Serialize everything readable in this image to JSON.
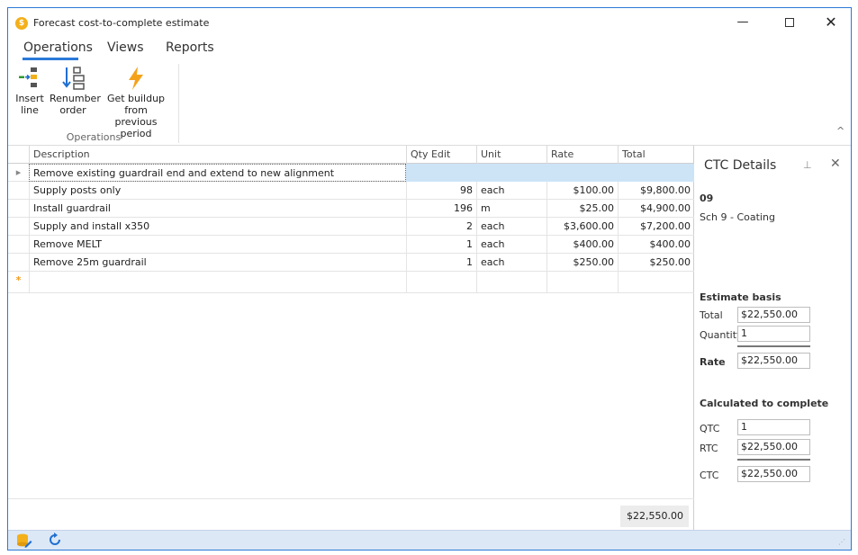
{
  "window": {
    "title": "Forecast cost-to-complete estimate",
    "icon_glyph": "$",
    "controls": {
      "minimize": "—",
      "maximize": "□",
      "close": "✕"
    }
  },
  "ribbon": {
    "tabs": [
      "Operations",
      "Views",
      "Reports"
    ],
    "active_tab": "Operations",
    "buttons": [
      {
        "label": "Insert line",
        "line1": "Insert",
        "line2": "line",
        "icon": "insert-line-icon"
      },
      {
        "label": "Renumber order",
        "line1": "Renumber",
        "line2": "order",
        "icon": "renumber-order-icon"
      },
      {
        "label": "Get buildup from previous period",
        "line1": "Get buildup from",
        "line2": "previous period",
        "icon": "lightning-icon"
      }
    ],
    "group_label": "Operations",
    "collapse_glyph": "^"
  },
  "grid": {
    "columns": [
      "Description",
      "Qty Edit",
      "Unit",
      "Rate",
      "Total"
    ],
    "rows": [
      {
        "indicator": "▸",
        "description": "Remove existing guardrail end and extend to new alignment",
        "qty": "",
        "unit": "",
        "rate": "",
        "total": "",
        "selected": true
      },
      {
        "indicator": "",
        "description": "Supply posts only",
        "qty": "98",
        "unit": "each",
        "rate": "$100.00",
        "total": "$9,800.00"
      },
      {
        "indicator": "",
        "description": "Install guardrail",
        "qty": "196",
        "unit": "m",
        "rate": "$25.00",
        "total": "$4,900.00"
      },
      {
        "indicator": "",
        "description": "Supply and install x350",
        "qty": "2",
        "unit": "each",
        "rate": "$3,600.00",
        "total": "$7,200.00"
      },
      {
        "indicator": "",
        "description": "Remove MELT",
        "qty": "1",
        "unit": "each",
        "rate": "$400.00",
        "total": "$400.00"
      },
      {
        "indicator": "",
        "description": "Remove 25m guardrail",
        "qty": "1",
        "unit": "each",
        "rate": "$250.00",
        "total": "$250.00"
      }
    ],
    "new_row_marker": "*",
    "footer_total": "$22,550.00"
  },
  "ctc_panel": {
    "title": "CTC Details",
    "pin_glyph": "⊥",
    "close_glyph": "✕",
    "code": "09",
    "schedule": "Sch 9 - Coating",
    "estimate_basis": {
      "heading": "Estimate basis",
      "total_label": "Total",
      "total_value": "$22,550.00",
      "quantity_label": "Quantity",
      "quantity_value": "1",
      "rate_label": "Rate",
      "rate_value": "$22,550.00"
    },
    "calculated": {
      "heading": "Calculated to complete",
      "qtc_label": "QTC",
      "qtc_value": "1",
      "rtc_label": "RTC",
      "rtc_value": "$22,550.00",
      "ctc_label": "CTC",
      "ctc_value": "$22,550.00"
    }
  },
  "statusbar": {
    "icons": [
      "database-edit-icon",
      "refresh-icon"
    ],
    "grip": "⋰"
  },
  "colors": {
    "accent": "#2b79d8",
    "selection": "#cde4f7",
    "status_bar": "#dce8f6",
    "icon_orange": "#f3b01a"
  }
}
